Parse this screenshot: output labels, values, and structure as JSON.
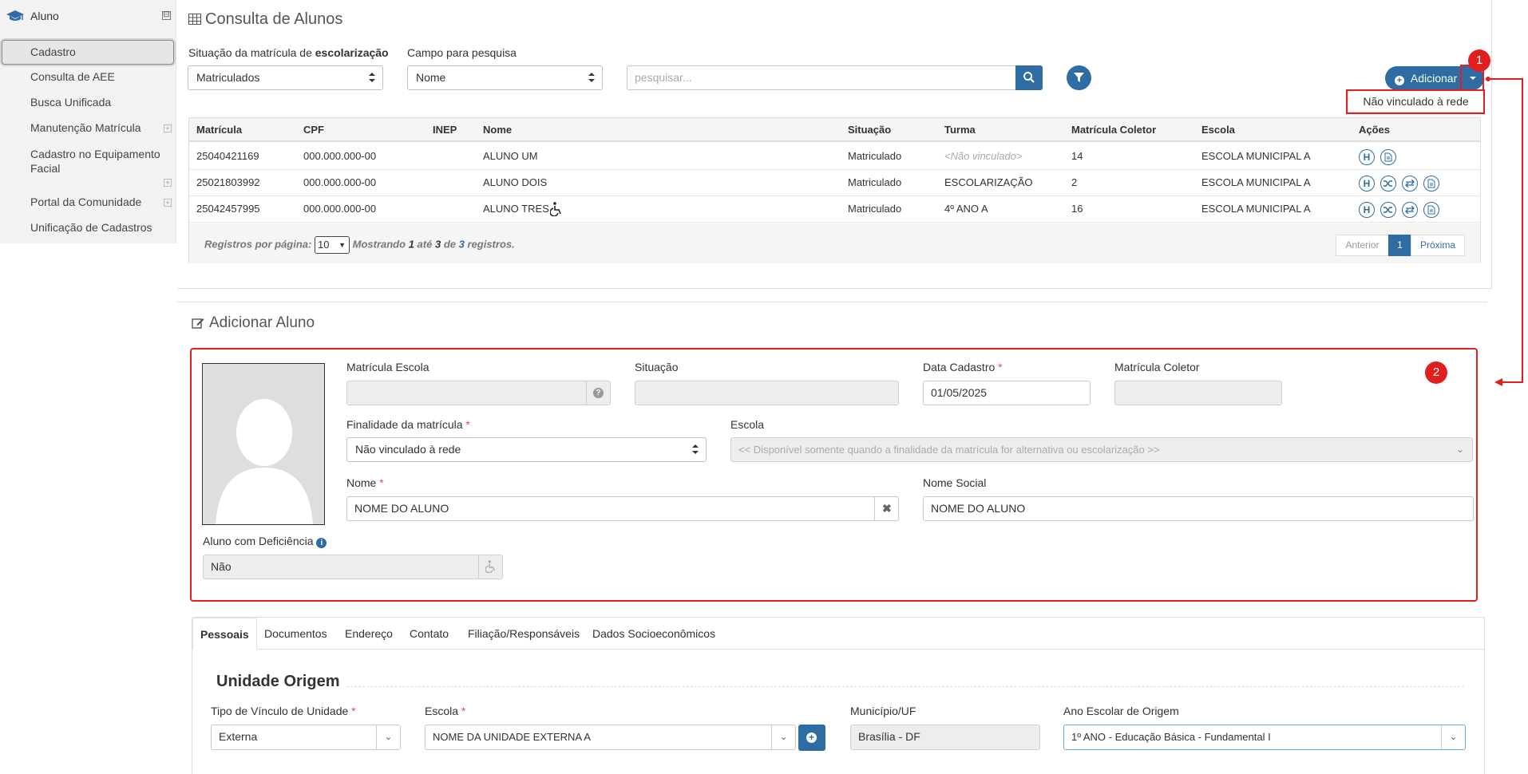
{
  "sidebar": {
    "title": "Aluno",
    "toggle": "⊟",
    "items": [
      {
        "label": "Cadastro"
      },
      {
        "label": "Consulta de AEE"
      },
      {
        "label": "Busca Unificada"
      },
      {
        "label": "Manutenção Matrícula"
      },
      {
        "label": "Cadastro no Equipamento"
      },
      {
        "label": "Facial"
      },
      {
        "label": "Portal da Comunidade"
      },
      {
        "label": "Unificação de Cadastros"
      }
    ]
  },
  "search": {
    "title": "Consulta de Alunos",
    "situacao_label_prefix": "Situação da matrícula de",
    "situacao_label_bold": "escolarização",
    "situacao_value": "Matriculados",
    "campo_label": "Campo para pesquisa",
    "campo_value": "Nome",
    "search_placeholder": "pesquisar...",
    "add_label": "Adicionar",
    "dropdown_item": "Não vinculado à rede"
  },
  "badges": {
    "one": "1",
    "two": "2"
  },
  "table": {
    "headers": [
      "Matrícula",
      "CPF",
      "INEP",
      "Nome",
      "Situação",
      "Turma",
      "Matrícula Coletor",
      "Escola",
      "Ações"
    ],
    "rows": [
      {
        "matricula": "25040421169",
        "cpf": "000.000.000-00",
        "inep": "",
        "nome": "ALUNO UM",
        "situacao": "Matriculado",
        "turma": "<Não vinculado>",
        "coletor": "14",
        "escola": "ESCOLA MUNICIPAL A"
      },
      {
        "matricula": "25021803992",
        "cpf": "000.000.000-00",
        "inep": "",
        "nome": "ALUNO DOIS",
        "situacao": "Matriculado",
        "turma": "ESCOLARIZAÇÃO",
        "coletor": "2",
        "escola": "ESCOLA MUNICIPAL A"
      },
      {
        "matricula": "25042457995",
        "cpf": "000.000.000-00",
        "inep": "",
        "nome": "ALUNO TRES",
        "situacao": "Matriculado",
        "turma": "4º ANO A",
        "coletor": "16",
        "escola": "ESCOLA MUNICIPAL A"
      }
    ],
    "footer": {
      "per_page_label": "Registros por página:",
      "per_page_value": "10",
      "mostrando": "Mostrando",
      "from": "1",
      "ate": "até",
      "to": "3",
      "de": "de",
      "total": "3",
      "registros": "registros.",
      "prev": "Anterior",
      "page": "1",
      "next": "Próxima"
    },
    "action_h": "H"
  },
  "form": {
    "title": "Adicionar Aluno",
    "matricula_escola_label": "Matrícula Escola",
    "situacao_label": "Situação",
    "data_cadastro_label": "Data Cadastro",
    "data_cadastro_value": "01/05/2025",
    "matricula_coletor_label": "Matrícula Coletor",
    "finalidade_label": "Finalidade da matrícula",
    "finalidade_value": "Não vinculado à rede",
    "escola_label": "Escola",
    "escola_placeholder": "<< Disponível somente quando a finalidade da matrícula for alternativa ou escolarização >>",
    "nome_label": "Nome",
    "nome_value": "NOME DO ALUNO",
    "nome_social_label": "Nome Social",
    "nome_social_value": "NOME DO ALUNO",
    "deficiencia_label": "Aluno com Deficiência",
    "deficiencia_value": "Não",
    "required_mark": "*"
  },
  "tabs": {
    "items": [
      "Pessoais",
      "Documentos",
      "Endereço",
      "Contato",
      "Filiação/Responsáveis",
      "Dados Socioeconômicos"
    ]
  },
  "origem": {
    "legend": "Unidade Origem",
    "tipo_label": "Tipo de Vínculo de Unidade",
    "tipo_value": "Externa",
    "escola_label": "Escola",
    "escola_value": "NOME DA UNIDADE EXTERNA A",
    "municipio_label": "Município/UF",
    "municipio_value": "Brasília - DF",
    "ano_label": "Ano Escolar de Origem",
    "ano_value": "1º ANO - Educação Básica - Fundamental I"
  },
  "colors": {
    "primary": "#2e6da4",
    "annotation": "#e0201f"
  }
}
